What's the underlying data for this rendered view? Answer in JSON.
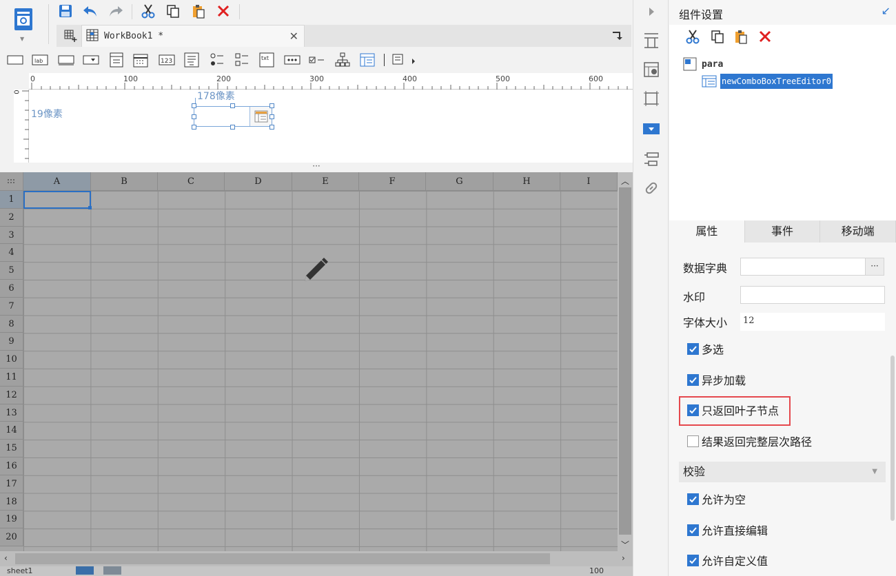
{
  "colors": {
    "accent": "#2e77d0",
    "grid_bg": "#aaaaaa",
    "highlight": "#e5484d"
  },
  "tab": {
    "label": "WorkBook1 *"
  },
  "ruler": {
    "marks": [
      "0",
      "100",
      "200",
      "300",
      "400",
      "500",
      "600"
    ],
    "v_mark": "0"
  },
  "canvas": {
    "top_label": "178像素",
    "left_label": "19像素"
  },
  "sheet": {
    "columns": [
      "A",
      "B",
      "C",
      "D",
      "E",
      "F",
      "G",
      "H",
      "I"
    ],
    "rows": [
      "1",
      "2",
      "3",
      "4",
      "5",
      "6",
      "7",
      "8",
      "9",
      "10",
      "11",
      "12",
      "13",
      "14",
      "15",
      "16",
      "17",
      "18",
      "19",
      "20"
    ],
    "sheet_tab": "sheet1",
    "zoom": "100"
  },
  "panel": {
    "title": "组件设置",
    "tree": {
      "root": "para",
      "child": "newComboBoxTreeEditor0"
    },
    "tabs": [
      "属性",
      "事件",
      "移动端"
    ],
    "props": {
      "dict_label": "数据字典",
      "dict_btn": "···",
      "watermark_label": "水印",
      "font_size_label": "字体大小",
      "font_size_value": "12"
    },
    "checks": [
      {
        "label": "多选",
        "checked": true
      },
      {
        "label": "异步加载",
        "checked": true
      },
      {
        "label": "只返回叶子节点",
        "checked": true
      },
      {
        "label": "结果返回完整层次路径",
        "checked": false
      }
    ],
    "validation": {
      "title": "校验",
      "checks": [
        {
          "label": "允许为空",
          "checked": true
        },
        {
          "label": "允许直接编辑",
          "checked": true
        },
        {
          "label": "允许自定义值",
          "checked": true
        }
      ]
    }
  }
}
